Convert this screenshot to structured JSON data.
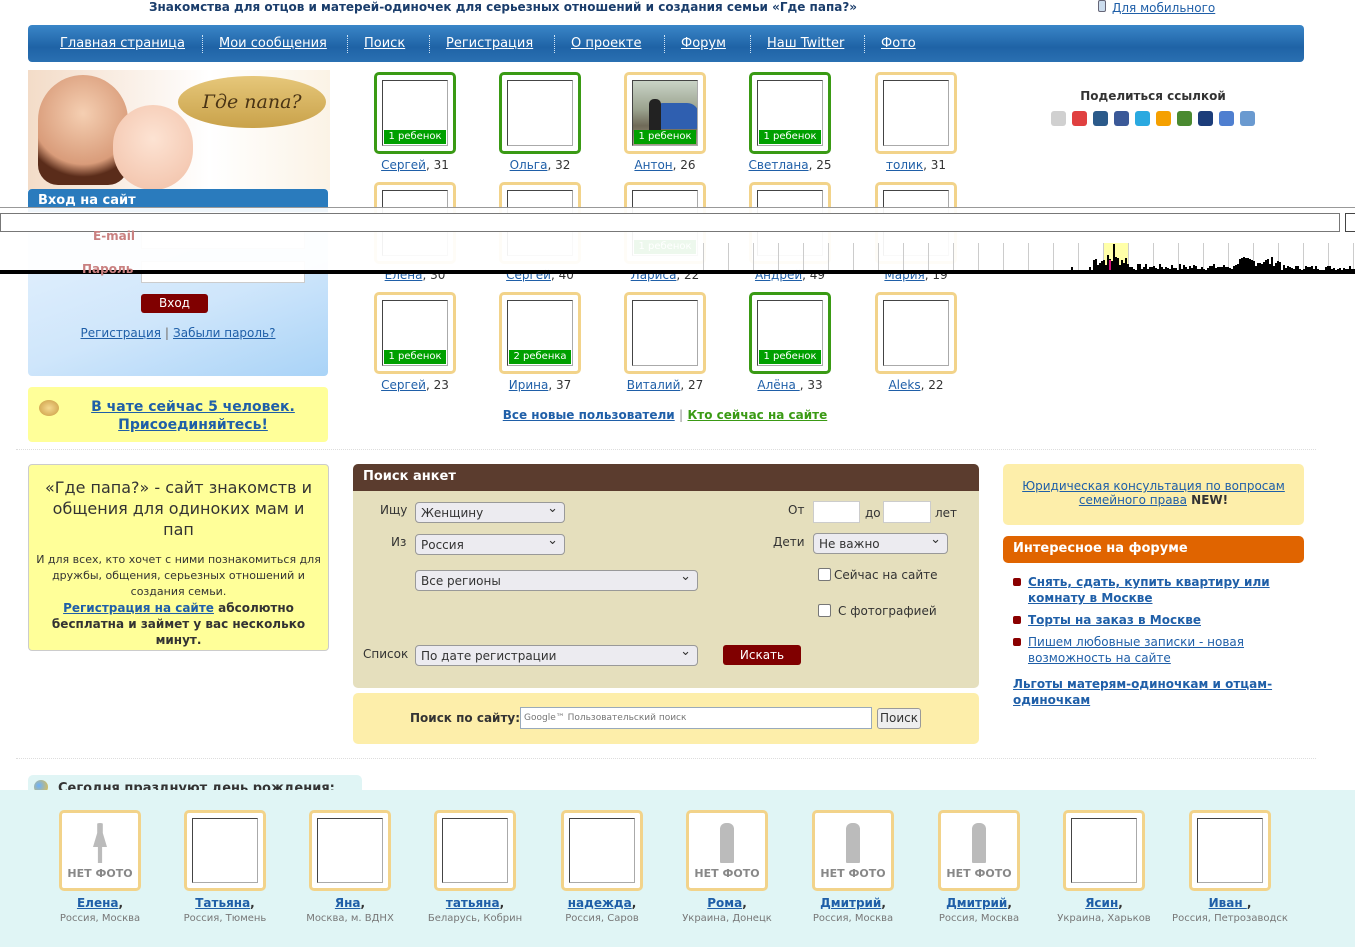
{
  "header": {
    "tagline": "Знакомства для отцов и матерей-одиночек для серьезных отношений и создания семьи «Где папа?»",
    "mobile_link": "Для мобильного",
    "logo_text": "Где папа?"
  },
  "nav": [
    "Главная страница",
    "Мои сообщения",
    "Поиск",
    "Регистрация",
    "О проекте",
    "Форум",
    "Наш Twitter",
    "Фото"
  ],
  "login": {
    "title": "Вход на сайт",
    "email_label": "E-mail",
    "password_label": "Пароль",
    "submit": "Вход",
    "register": "Регистрация",
    "sep": "|",
    "forgot": "Забыли пароль?"
  },
  "chat": {
    "text": "В чате сейчас 5 человек. Присоединяйтесь!"
  },
  "profiles": [
    {
      "name": "Сергей",
      "age": ", 31",
      "badge": "1 ребенок",
      "online": true
    },
    {
      "name": "Ольга",
      "age": ", 32",
      "badge": "",
      "online": true
    },
    {
      "name": "Антон",
      "age": ", 26",
      "badge": "1 ребенок",
      "online": false,
      "photo": true
    },
    {
      "name": "Светлана",
      "age": ", 25",
      "badge": "1 ребенок",
      "online": true
    },
    {
      "name": "толик",
      "age": ", 31",
      "badge": "",
      "online": false
    },
    {
      "name": "Елена",
      "age": ", 30",
      "badge": "",
      "online": false
    },
    {
      "name": "Сергей",
      "age": ", 40",
      "badge": "",
      "online": false
    },
    {
      "name": "Лариса",
      "age": ", 22",
      "badge": "1 ребенок",
      "online": false
    },
    {
      "name": "Андрей",
      "age": ", 49",
      "badge": "",
      "online": false
    },
    {
      "name": "Мария",
      "age": ", 19",
      "badge": "",
      "online": false
    },
    {
      "name": "Сергей",
      "age": ", 23",
      "badge": "1 ребенок",
      "online": false
    },
    {
      "name": "Ирина",
      "age": ", 37",
      "badge": "2 ребенка",
      "online": false
    },
    {
      "name": "Виталий",
      "age": ", 27",
      "badge": "",
      "online": false
    },
    {
      "name": "Алёна ",
      "age": ", 33",
      "badge": "1 ребенок",
      "online": true
    },
    {
      "name": "Aleks",
      "age": ", 22",
      "badge": "",
      "online": false
    }
  ],
  "profile_links": {
    "all_new": "Все новые пользователи",
    "sep": "|",
    "online": "Кто сейчас на сайте"
  },
  "share": {
    "title": "Поделиться ссылкой",
    "icons": [
      "mail-ru-icon",
      "ya-ru-icon",
      "vkontakte-icon",
      "facebook-icon",
      "twitter-icon",
      "odnoklassniki-icon",
      "moi-krug-icon",
      "livejournal-icon",
      "friendfeed-icon",
      "google-buzz-icon"
    ],
    "colors": [
      "#d0d0d0",
      "#e04040",
      "#2b5a8a",
      "#3b5998",
      "#2aa9e0",
      "#f5a000",
      "#4a8a30",
      "#1c3d7a",
      "#4f7fd0",
      "#6a9ad0"
    ]
  },
  "info": {
    "title": "«Где папа?» - сайт знакомств и общения для одиноких мам и пап",
    "text": "И для всех, кто хочет с ними познакомиться для дружбы, общения, серьезных отношений и создания семьи.",
    "reg_link": "Регистрация на сайте",
    "reg_text": " абсолютно бесплатна и займет у вас несколько минут."
  },
  "search": {
    "title": "Поиск анкет",
    "seek_label": "Ищу",
    "seek_value": "Женщину",
    "from_label": "Из",
    "country_value": "Россия",
    "region_value": "Все регионы",
    "age_from_label": "От",
    "age_to_label": "до",
    "age_unit": "лет",
    "age_from": "",
    "age_to": "",
    "kids_label": "Дети",
    "kids_value": "Не важно",
    "online_label": "Сейчас на сайте",
    "photo_label": "С фотографией",
    "online_checked": false,
    "photo_checked": false,
    "list_label": "Список",
    "list_value": "По дате регистрации",
    "submit": "Искать"
  },
  "site_search": {
    "label": "Поиск по сайту:",
    "placeholder": "Google™ Пользовательский поиск",
    "button": "Поиск"
  },
  "legal": {
    "link": "Юридическая консультация по вопросам семейного права",
    "badge": " NEW!"
  },
  "forum": {
    "title": "Интересное на форуме",
    "items": [
      "Снять, сдать, купить квартиру или комнату в Москве",
      "Торты на заказ в Москве",
      "Пишем любовные записки - новая возможность на сайте"
    ],
    "extra": "Льготы матерям-одиночкам и отцам-одиночкам"
  },
  "birthdays": {
    "title": "Сегодня празднуют день рождения:",
    "no_photo": "НЕТ ФОТО",
    "people": [
      {
        "name": "Елена",
        "loc": "Россия, Москва",
        "nophoto": "female"
      },
      {
        "name": "Татьяна",
        "loc": "Россия, Тюмень"
      },
      {
        "name": "Яна",
        "loc": "Москва, м. ВДНХ"
      },
      {
        "name": "татьяна",
        "loc": "Беларусь, Кобрин"
      },
      {
        "name": "надежда",
        "loc": "Россия, Саров"
      },
      {
        "name": "Рома",
        "loc": "Украина, Донецк",
        "nophoto": "male"
      },
      {
        "name": "Дмитрий",
        "loc": "Россия, Москва",
        "nophoto": "male"
      },
      {
        "name": "Дмитрий",
        "loc": "Россия, Москва",
        "nophoto": "male"
      },
      {
        "name": "Ясин",
        "loc": "Украина, Харьков"
      },
      {
        "name": "Иван ",
        "loc": "Россия, Петрозаводск"
      }
    ]
  },
  "colors": {
    "nav": "#2a70b2",
    "search_header": "#5b3c2e",
    "forum_header": "#e06400",
    "online_border": "#3a9a14",
    "badge": "#00a000",
    "button": "#800000"
  }
}
